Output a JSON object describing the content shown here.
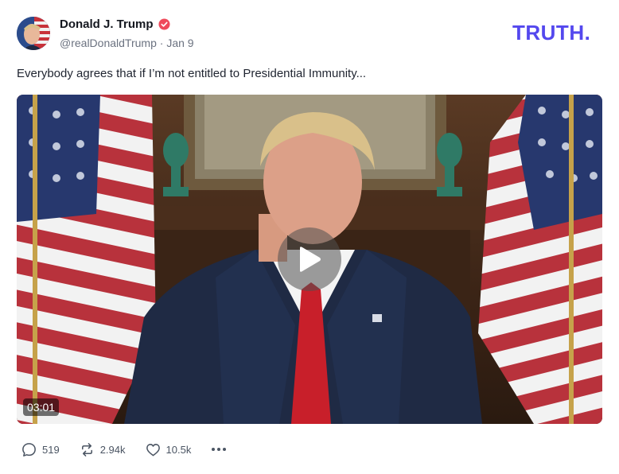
{
  "author": {
    "name": "Donald J. Trump",
    "handle": "@realDonaldTrump",
    "separator": "·",
    "date": "Jan 9",
    "verified": true
  },
  "brand": {
    "logo_text": "TRUTH.",
    "color": "#5448ee"
  },
  "post": {
    "text": "Everybody agrees that if I’m not entitled to Presidential Immunity...",
    "video": {
      "duration": "03:01",
      "play_icon": "play-icon"
    }
  },
  "actions": {
    "replies": "519",
    "retruths": "2.94k",
    "likes": "10.5k",
    "more_icon": "more-icon"
  },
  "colors": {
    "verified": "#ef4a5b",
    "text": "#1f2430",
    "muted": "#6b7280"
  }
}
